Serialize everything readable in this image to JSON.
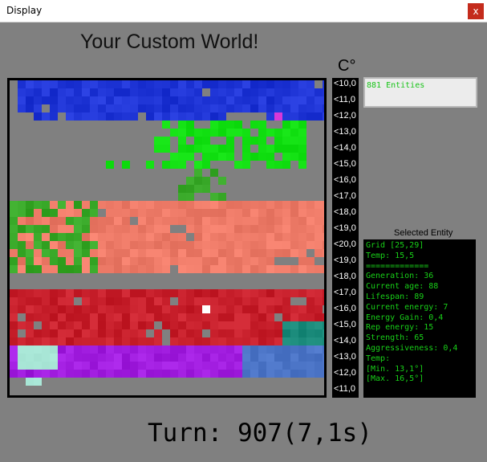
{
  "window": {
    "title": "Display",
    "close_glyph": "x"
  },
  "heading": "Your Custom World!",
  "scale": {
    "unit": "C°",
    "labels": [
      "<10,0",
      "<11,0",
      "<12,0",
      "<13,0",
      "<14,0",
      "<15,0",
      "<16,0",
      "<17,0",
      "<18,0",
      "<19,0",
      "<20,0",
      "<19,0",
      "<18,0",
      "<17,0",
      "<16,0",
      "<15,0",
      "<14,0",
      "<13,0",
      "<12,0",
      "<11,0"
    ]
  },
  "entities": {
    "count_text": "881 Entities"
  },
  "selected_entity": {
    "title": "Selected Entity",
    "lines": [
      "Grid [25,29]",
      "Temp: 15,5",
      "=============",
      "Generation: 36",
      "Current age: 88",
      "Lifespan: 89",
      "Current energy: 7",
      "Energy Gain: 0,4",
      "Rep energy: 15",
      "Strength: 65",
      "Aggressiveness: 0,4",
      "Temp:",
      "[Min. 13,1°]",
      "[Max. 16,5°]"
    ]
  },
  "turn": {
    "text": "Turn: 907(7,1s)"
  },
  "colors": {
    "background": "#808080",
    "blue": "#1f35d6",
    "green": "#12e012",
    "salmon": "#ee7b68",
    "grass": "#38a828",
    "red": "#c8202c",
    "purple": "#a21ee0",
    "teal": "#1a8a7a",
    "steel": "#4b74c6",
    "mint": "#a8e6d6",
    "magenta": "#d838d8",
    "highlight": "#ffffff"
  }
}
